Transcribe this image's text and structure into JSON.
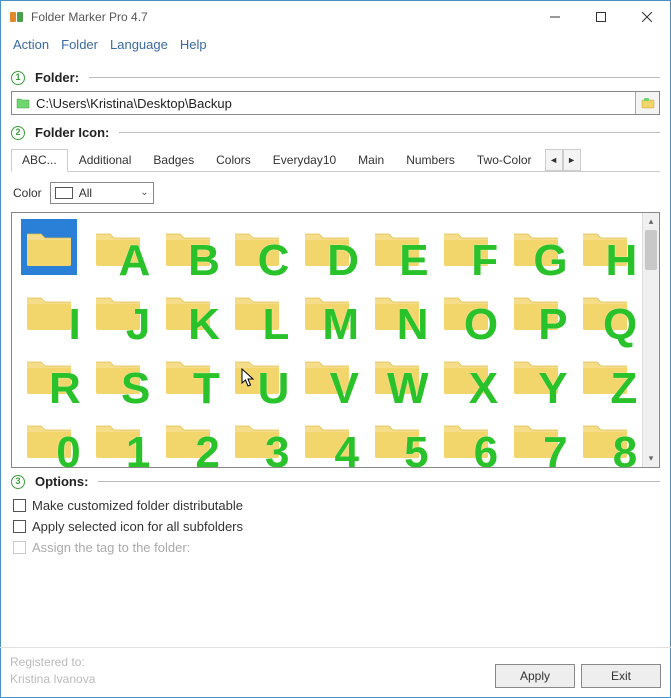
{
  "window": {
    "title": "Folder Marker Pro 4.7"
  },
  "menu": {
    "action": "Action",
    "folder": "Folder",
    "language": "Language",
    "help": "Help"
  },
  "section1": {
    "num": "1",
    "label": "Folder:"
  },
  "path": {
    "value": "C:\\Users\\Kristina\\Desktop\\Backup"
  },
  "section2": {
    "num": "2",
    "label": "Folder Icon:"
  },
  "tabs": {
    "items": [
      {
        "label": "ABC...",
        "active": true
      },
      {
        "label": "Additional",
        "active": false
      },
      {
        "label": "Badges",
        "active": false
      },
      {
        "label": "Colors",
        "active": false
      },
      {
        "label": "Everyday10",
        "active": false
      },
      {
        "label": "Main",
        "active": false
      },
      {
        "label": "Numbers",
        "active": false
      },
      {
        "label": "Two-Color",
        "active": false
      }
    ]
  },
  "color_filter": {
    "label": "Color",
    "value": "All"
  },
  "icons": {
    "row1": [
      "",
      "A",
      "B",
      "C",
      "D",
      "E",
      "F",
      "G",
      "H"
    ],
    "row2": [
      "I",
      "J",
      "K",
      "L",
      "M",
      "N",
      "O",
      "P",
      "Q"
    ],
    "row3": [
      "R",
      "S",
      "T",
      "U",
      "V",
      "W",
      "X",
      "Y",
      "Z"
    ],
    "row4": [
      "0",
      "1",
      "2",
      "3",
      "4",
      "5",
      "6",
      "7",
      "8"
    ]
  },
  "section3": {
    "num": "3",
    "label": "Options:"
  },
  "options": {
    "opt1": "Make customized folder distributable",
    "opt2": "Apply selected icon for all subfolders",
    "opt3": "Assign the tag to the folder:"
  },
  "footer": {
    "reg_label": "Registered to:",
    "reg_name": "Kristina Ivanova",
    "apply": "Apply",
    "exit": "Exit"
  }
}
